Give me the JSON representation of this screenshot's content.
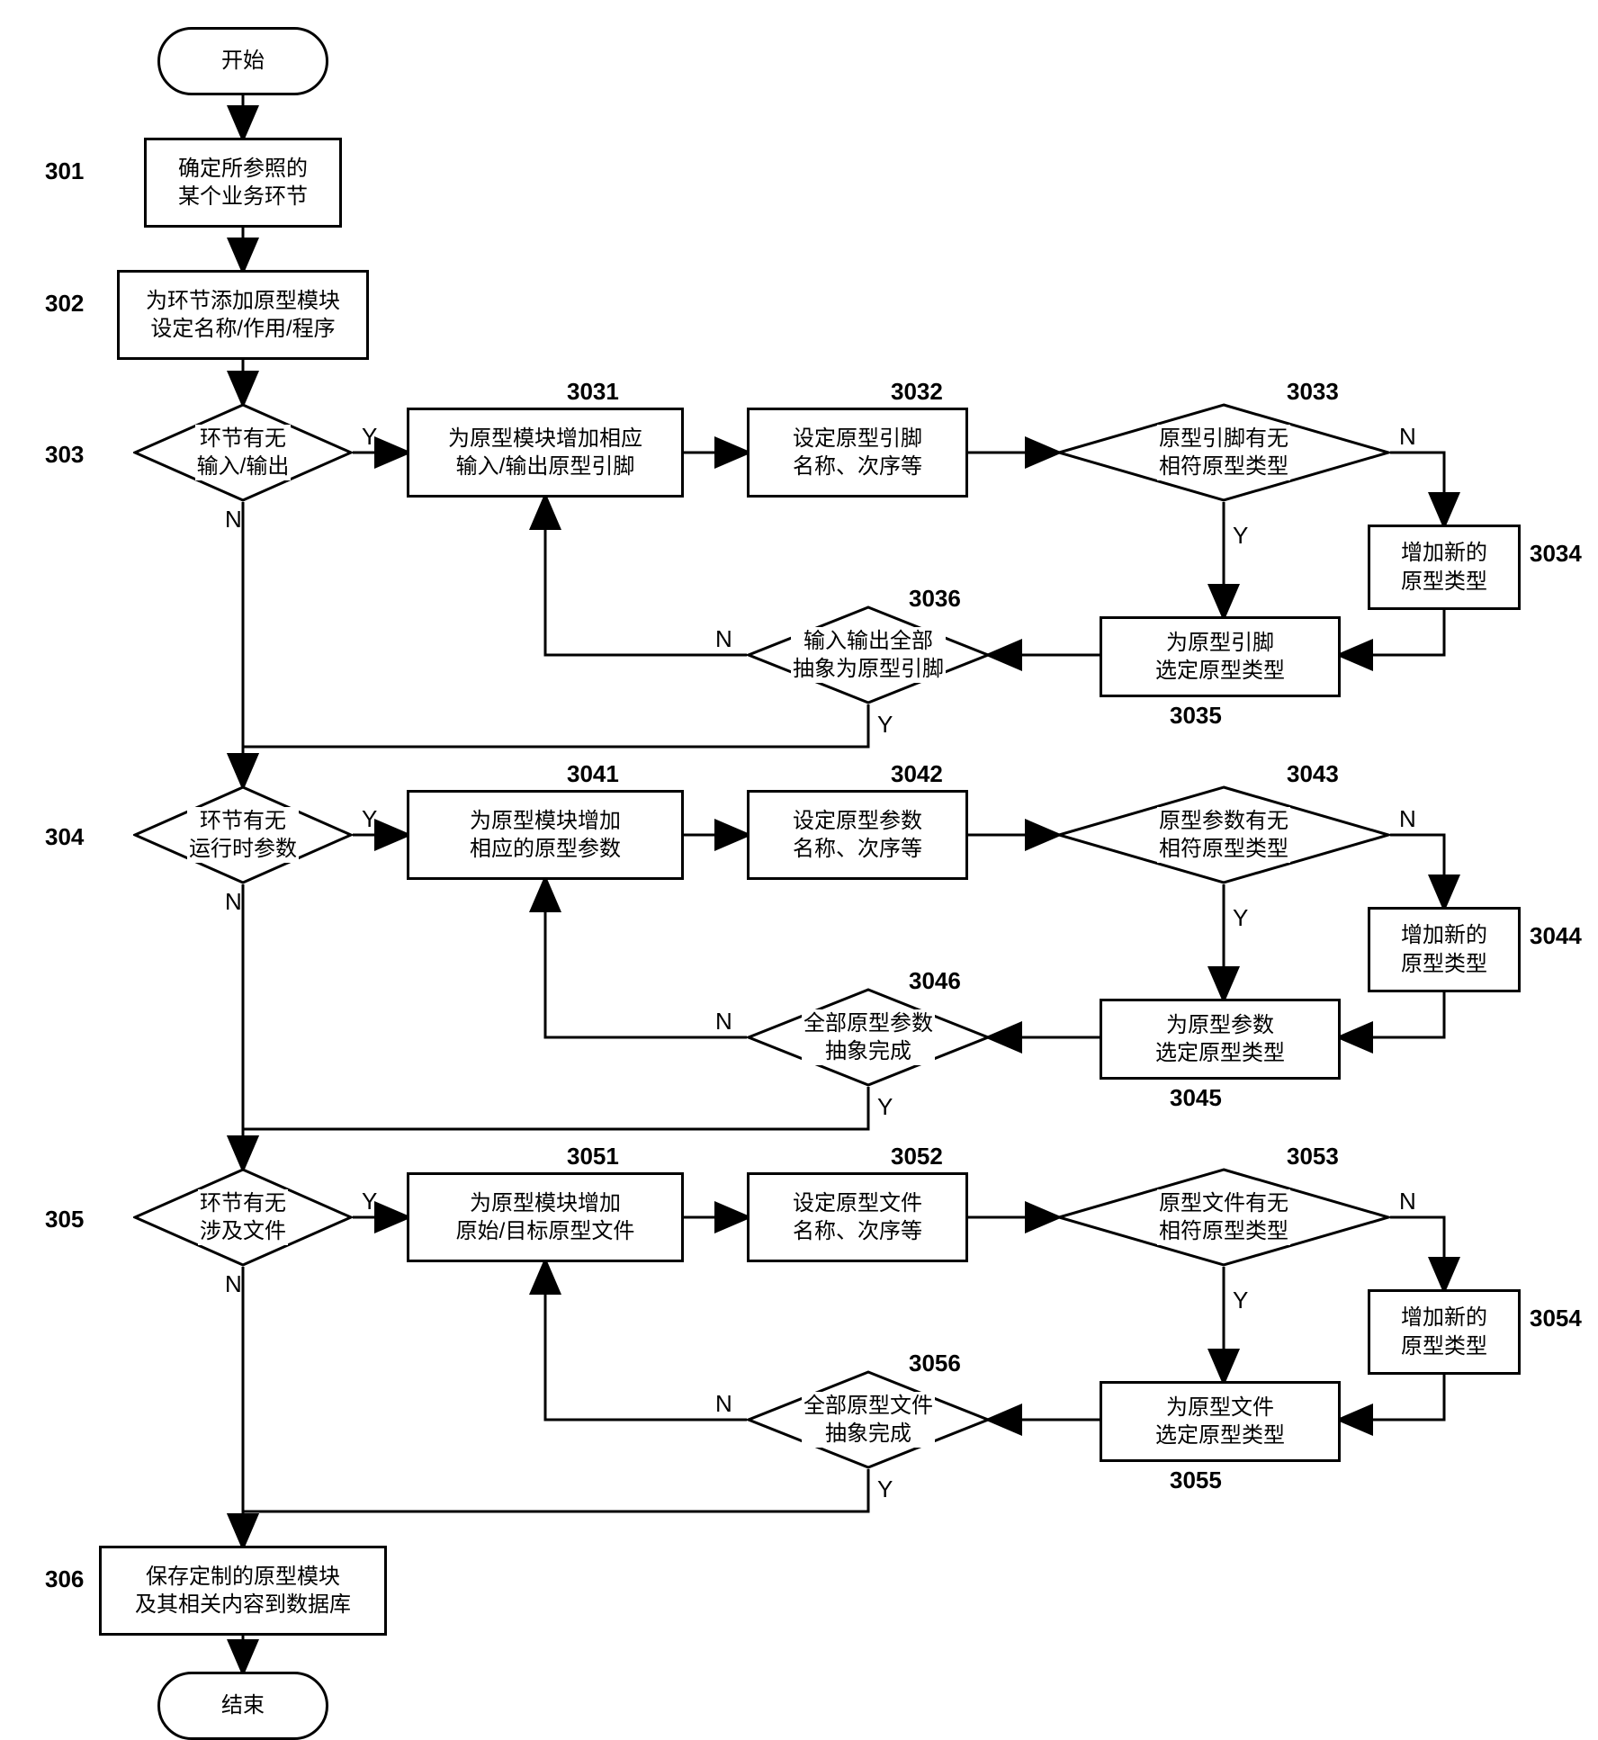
{
  "terminator": {
    "start": "开始",
    "end": "结束"
  },
  "step": {
    "s301": "确定所参照的\n某个业务环节",
    "s302": "为环节添加原型模块\n设定名称/作用/程序",
    "s306": "保存定制的原型模块\n及其相关内容到数据库"
  },
  "decision": {
    "d303": "环节有无\n输入/输出",
    "d304": "环节有无\n运行时参数",
    "d305": "环节有无\n涉及文件",
    "d3033": "原型引脚有无\n相符原型类型",
    "d3036": "输入输出全部\n抽象为原型引脚",
    "d3043": "原型参数有无\n相符原型类型",
    "d3046": "全部原型参数\n抽象完成",
    "d3053": "原型文件有无\n相符原型类型",
    "d3056": "全部原型文件\n抽象完成"
  },
  "proc": {
    "p3031": "为原型模块增加相应\n输入/输出原型引脚",
    "p3032": "设定原型引脚\n名称、次序等",
    "p3034": "增加新的\n原型类型",
    "p3035": "为原型引脚\n选定原型类型",
    "p3041": "为原型模块增加\n相应的原型参数",
    "p3042": "设定原型参数\n名称、次序等",
    "p3044": "增加新的\n原型类型",
    "p3045": "为原型参数\n选定原型类型",
    "p3051": "为原型模块增加\n原始/目标原型文件",
    "p3052": "设定原型文件\n名称、次序等",
    "p3054": "增加新的\n原型类型",
    "p3055": "为原型文件\n选定原型类型"
  },
  "label": {
    "l301": "301",
    "l302": "302",
    "l303": "303",
    "l304": "304",
    "l305": "305",
    "l306": "306",
    "l3031": "3031",
    "l3032": "3032",
    "l3033": "3033",
    "l3034": "3034",
    "l3035": "3035",
    "l3036": "3036",
    "l3041": "3041",
    "l3042": "3042",
    "l3043": "3043",
    "l3044": "3044",
    "l3045": "3045",
    "l3046": "3046",
    "l3051": "3051",
    "l3052": "3052",
    "l3053": "3053",
    "l3054": "3054",
    "l3055": "3055",
    "l3056": "3056"
  },
  "yn": {
    "y": "Y",
    "n": "N"
  }
}
